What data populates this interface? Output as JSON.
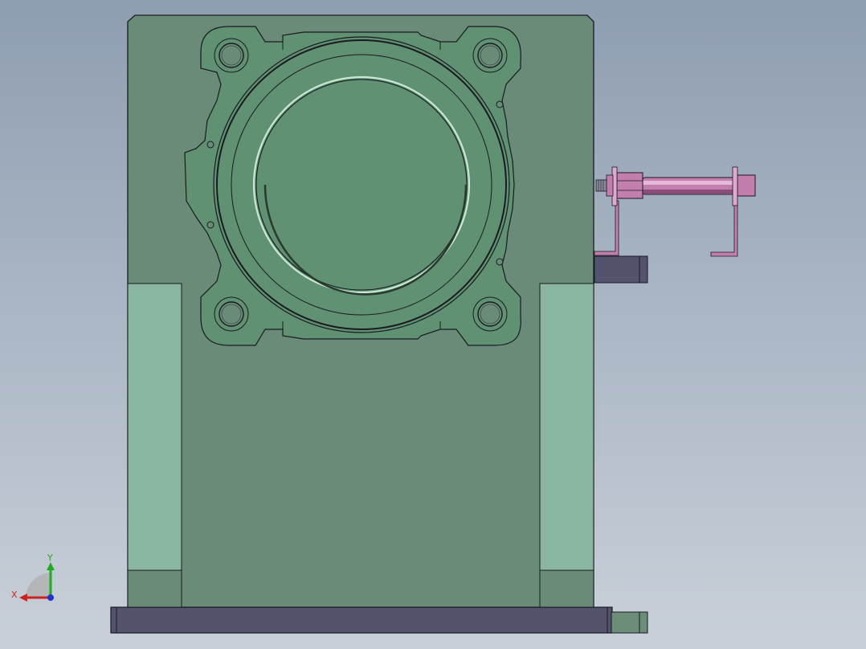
{
  "viewport": {
    "background_top": "#8e9db0",
    "background_bottom": "#c9d0d9"
  },
  "model": {
    "housing_color": "#698b78",
    "flange_color": "#5f9172",
    "rail_color": "#8ab5a0",
    "base_color": "#54536e",
    "cylinder_color": "#c27fae"
  },
  "triad": {
    "x_label": "X",
    "y_label": "Y",
    "x_color": "#cc2222",
    "y_color": "#22aa22",
    "z_color": "#2233cc"
  }
}
